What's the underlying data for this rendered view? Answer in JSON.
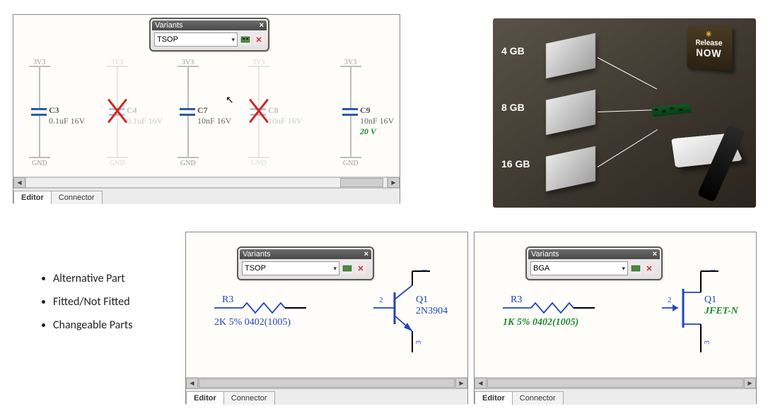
{
  "top_panel": {
    "variants": {
      "title": "Variants",
      "value": "TSOP"
    },
    "components": [
      {
        "net_top": "3V3",
        "net_bot": "GND",
        "ref": "C3",
        "value": "0.1uF 16V",
        "fitted": true
      },
      {
        "net_top": "3V3",
        "net_bot": "GND",
        "ref": "C4",
        "value": "0.1uF 16V",
        "fitted": false
      },
      {
        "net_top": "3V3",
        "net_bot": "GND",
        "ref": "C7",
        "value": "10nF 16V",
        "fitted": true
      },
      {
        "net_top": "3V3",
        "net_bot": "GND",
        "ref": "C8",
        "value": "10nF 16V",
        "fitted": false
      },
      {
        "net_top": "3V3",
        "net_bot": "GND",
        "ref": "C9",
        "value": "10nF 16V",
        "fitted": true,
        "alt_value": "20 V"
      }
    ],
    "tabs": {
      "active": "Editor",
      "other": "Connector"
    }
  },
  "promo": {
    "sizes": [
      "4 GB",
      "8 GB",
      "16 GB"
    ],
    "release_line1": "Release",
    "release_line2": "NOW"
  },
  "bullets": [
    "Alternative Part",
    "Fitted/Not Fitted",
    "Changeable Parts"
  ],
  "bottom_left": {
    "variants": {
      "title": "Variants",
      "value": "TSOP"
    },
    "R": {
      "ref": "R3",
      "value": "2K 5% 0402(1005)"
    },
    "Q": {
      "ref": "Q1",
      "value": "2N3904",
      "pins": {
        "base": "2",
        "emitter": "3",
        "collector": "1"
      }
    },
    "tabs": {
      "active": "Editor",
      "other": "Connector"
    }
  },
  "bottom_right": {
    "variants": {
      "title": "Variants",
      "value": "BGA"
    },
    "R": {
      "ref": "R3",
      "value": "1K 5% 0402(1005)"
    },
    "Q": {
      "ref": "Q1",
      "value": "JFET-N",
      "pins": {
        "gate": "2",
        "source": "3",
        "drain": "1"
      }
    },
    "tabs": {
      "active": "Editor",
      "other": "Connector"
    }
  }
}
